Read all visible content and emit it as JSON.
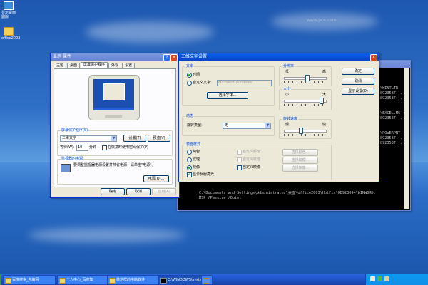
{
  "desktop": {
    "icons": [
      {
        "label": "显示桌面\n删除",
        "icon": "shortcut-icon"
      },
      {
        "label": "office2003",
        "icon": "folder-icon"
      }
    ],
    "watermark": "www.pc6.com"
  },
  "display_props": {
    "title": "显示 属性",
    "tabs": [
      "主题",
      "桌面",
      "屏幕保护程序",
      "外观",
      "设置"
    ],
    "selected_tab": 2,
    "screensaver_group": "屏幕保护程序(S)",
    "screensaver_value": "三维文字",
    "settings_btn": "设置(T)",
    "preview_btn": "预览(V)",
    "wait_label": "等待(W):",
    "wait_value": "10",
    "wait_unit": "分钟",
    "password_label": "在恢复时使用密码保护(P)",
    "power_group": "监视器的电源",
    "power_text": "要调整监视器电源设置并节省电源，请单击\"电源\"。",
    "power_btn": "电源(O)...",
    "ok": "确定",
    "cancel": "取消",
    "apply": "应用(A)"
  },
  "text3d": {
    "title": "三维文字设置",
    "text_group": "文本",
    "time_option": "时间",
    "custom_option": "自定义文字:",
    "custom_placeholder": "Microsoft Windows",
    "font_btn": "选择字体...",
    "res_group": "分辨率",
    "res_low": "低",
    "res_high": "高",
    "size_group": "大小",
    "size_small": "小",
    "size_large": "大",
    "motion_group": "动态",
    "rotation_label": "旋转类型:",
    "rotation_value": "无",
    "speed_group": "旋转速度",
    "speed_slow": "慢",
    "speed_fast": "快",
    "surface_group": "表面样式",
    "surface_options": [
      "纯色",
      "纹理",
      "映像"
    ],
    "surface_selected": 2,
    "custom_color": "自定义颜色",
    "custom_texture": "自定义纹理",
    "custom_reflection": "自定义映像",
    "choose_color": "选择颜色...",
    "choose_texture": "选择纹理...",
    "choose_reflection": "选择映像...",
    "specular": "显示反射亮光",
    "ok": "确定",
    "cancel": "取消",
    "about": "显示设置(D)"
  },
  "cmd": {
    "right_lines": [
      "\\WINTLTR",
      "8923587...",
      "8923587...",
      "\\EXCEL.MS",
      "8923587...",
      "\\POWERPNT",
      "8923587...",
      "8923587..."
    ],
    "lines": [
      "C:\\Documents and Settings\\Administrator\\桌面\\office2003\\HotFix\\KB923094\\WINWORD.",
      "MSP /Passive /Quiet"
    ]
  },
  "taskbar": {
    "items": [
      "百度搜索_电脑网",
      "个人中心_百度知",
      "装这样的电脑软件",
      "C:\\WINDOWS\\syste",
      ""
    ]
  }
}
